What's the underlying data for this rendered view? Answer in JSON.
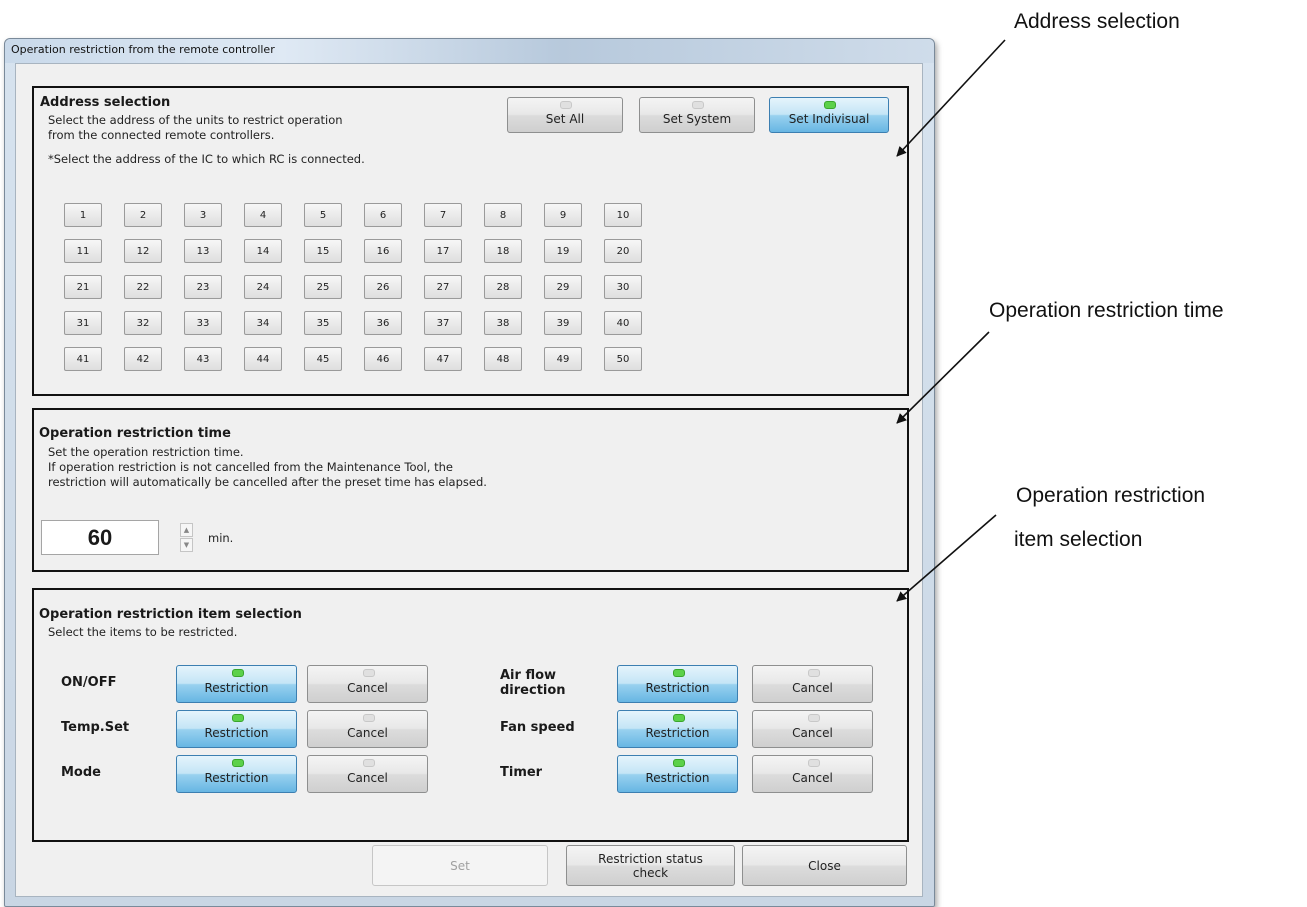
{
  "window": {
    "title": "Operation restriction from the remote controller"
  },
  "address_selection": {
    "title": "Address selection",
    "description": "Select the address of the units to restrict operation\nfrom the connected remote controllers.",
    "note": "*Select the address of the IC to which RC is connected.",
    "buttons": {
      "set_all": "Set All",
      "set_system": "Set System",
      "set_individual": "Set Indivisual",
      "selected": "set_individual"
    },
    "addresses": [
      "1",
      "2",
      "3",
      "4",
      "5",
      "6",
      "7",
      "8",
      "9",
      "10",
      "11",
      "12",
      "13",
      "14",
      "15",
      "16",
      "17",
      "18",
      "19",
      "20",
      "21",
      "22",
      "23",
      "24",
      "25",
      "26",
      "27",
      "28",
      "29",
      "30",
      "31",
      "32",
      "33",
      "34",
      "35",
      "36",
      "37",
      "38",
      "39",
      "40",
      "41",
      "42",
      "43",
      "44",
      "45",
      "46",
      "47",
      "48",
      "49",
      "50"
    ]
  },
  "restriction_time": {
    "title": "Operation restriction time",
    "description": "Set the operation restriction time.\nIf operation restriction is not cancelled from the Maintenance Tool, the\nrestriction will automatically be cancelled after the preset time has elapsed.",
    "value": "60",
    "unit": "min."
  },
  "item_selection": {
    "title": "Operation restriction item selection",
    "description": "Select the items to be restricted.",
    "restriction_label": "Restriction",
    "cancel_label": "Cancel",
    "items": [
      {
        "label": "ON/OFF",
        "state": "Restriction"
      },
      {
        "label": "Temp.Set",
        "state": "Restriction"
      },
      {
        "label": "Mode",
        "state": "Restriction"
      },
      {
        "label": "Air flow\ndirection",
        "state": "Restriction"
      },
      {
        "label": "Fan speed",
        "state": "Restriction"
      },
      {
        "label": "Timer",
        "state": "Restriction"
      }
    ]
  },
  "footer": {
    "set": "Set",
    "status_check": "Restriction status\ncheck",
    "close": "Close"
  },
  "annotations": {
    "address_selection": "Address selection",
    "restriction_time": "Operation restriction time",
    "item_selection_line1": "Operation restriction",
    "item_selection_line2": "item selection"
  },
  "colors": {
    "led_on": "#5cd14a",
    "selected_button": "#98d1ef"
  }
}
